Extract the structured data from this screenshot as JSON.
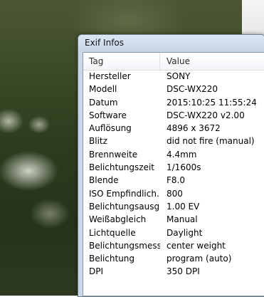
{
  "window": {
    "title": "Exif Infos"
  },
  "table": {
    "columns": [
      "Tag",
      "Value"
    ],
    "rows": [
      {
        "tag": "Hersteller",
        "value": "SONY"
      },
      {
        "tag": "Modell",
        "value": "DSC-WX220"
      },
      {
        "tag": "Datum",
        "value": "2015:10:25 11:55:24"
      },
      {
        "tag": "Software",
        "value": "DSC-WX220 v2.00"
      },
      {
        "tag": "Auflösung",
        "value": "4896 x 3672"
      },
      {
        "tag": "Blitz",
        "value": "did not fire (manual)"
      },
      {
        "tag": "Brennweite",
        "value": "4.4mm"
      },
      {
        "tag": "Belichtungszeit",
        "value": "1/1600s"
      },
      {
        "tag": "Blende",
        "value": "F8.0"
      },
      {
        "tag": "ISO Empfindlich...",
        "value": "800"
      },
      {
        "tag": "Belichtungsausgl...",
        "value": "1.00 EV"
      },
      {
        "tag": "Weißabgleich",
        "value": "Manual"
      },
      {
        "tag": "Lichtquelle",
        "value": "Daylight"
      },
      {
        "tag": "Belichtungsmess...",
        "value": "center weight"
      },
      {
        "tag": "Belichtung",
        "value": "program (auto)"
      },
      {
        "tag": "DPI",
        "value": "350 DPI"
      }
    ]
  }
}
